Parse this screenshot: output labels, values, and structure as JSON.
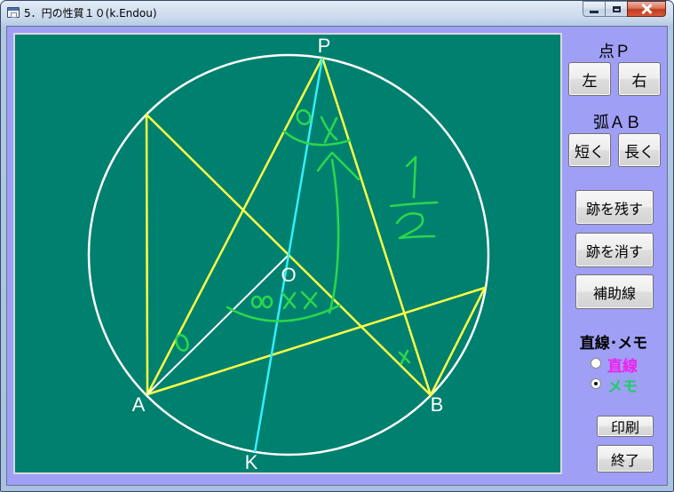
{
  "window": {
    "title": "5．円の性質１０(k.Endou)",
    "app_icon": "app-window-icon",
    "controls": [
      {
        "name": "minimize",
        "icon": "minimize-icon"
      },
      {
        "name": "maximize",
        "icon": "maximize-icon"
      },
      {
        "name": "close",
        "icon": "close-icon"
      }
    ]
  },
  "colors": {
    "client_background": "#9f9ff5",
    "canvas_background": "#00806f",
    "circle": "#ffffff",
    "construction_lines": "#ffff44",
    "radius_line": "#ffffff",
    "diameter_line": "#33eeff",
    "point_labels": "#ffffff",
    "memo_ink": "#2ad64d",
    "radio_line_label": "#ee22ee",
    "radio_memo_label": "#22cc66"
  },
  "canvas": {
    "point_labels": {
      "P": "P",
      "A": "A",
      "B": "B",
      "O": "O",
      "K": "K"
    }
  },
  "panel": {
    "point_p": {
      "label": "点Ｐ",
      "left": "左",
      "right": "右"
    },
    "arc_ab": {
      "label": "弧ＡＢ",
      "shorter": "短く",
      "longer": "長く"
    },
    "trace_keep": "跡を残す",
    "trace_clear": "跡を消す",
    "auxiliary_line": "補助線",
    "mode": {
      "label": "直線･メモ",
      "options": [
        {
          "label": "直線",
          "checked": false
        },
        {
          "label": "メモ",
          "checked": true
        }
      ]
    },
    "print": "印刷",
    "quit": "終了"
  }
}
